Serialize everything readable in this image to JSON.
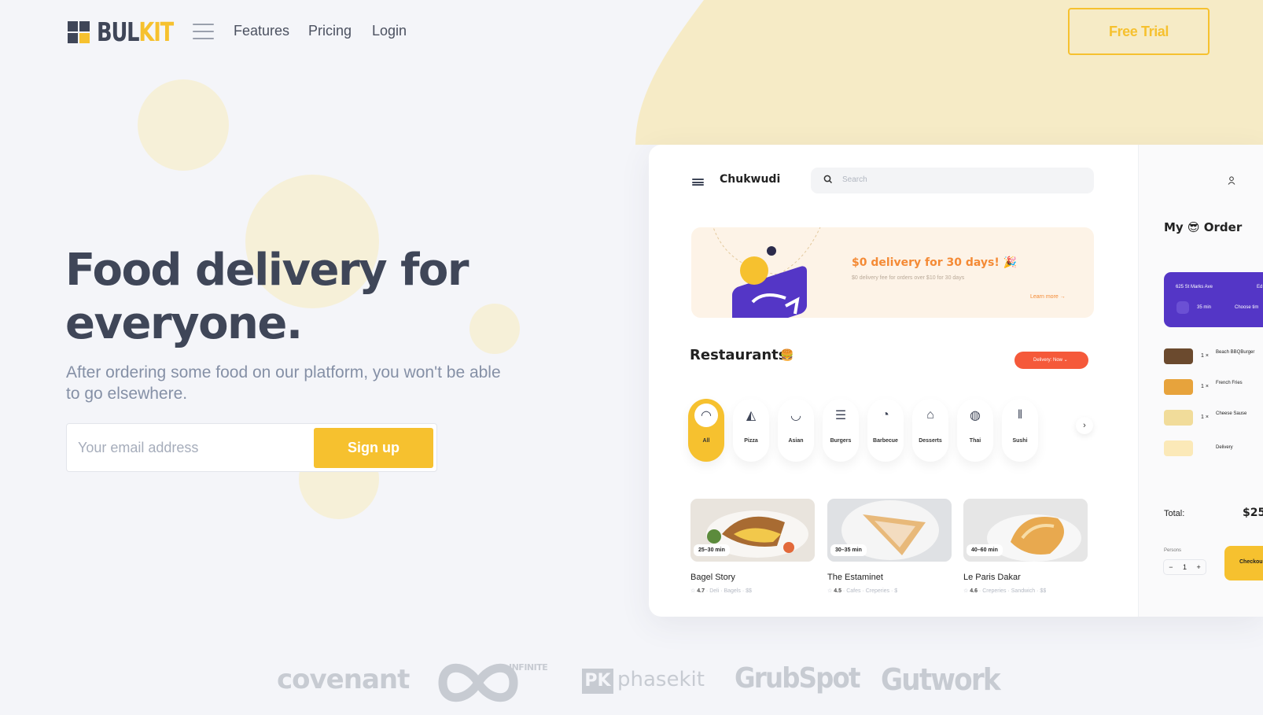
{
  "logo": {
    "text_a": "BUL",
    "text_b": "KIT"
  },
  "nav": {
    "links": [
      "Features",
      "Pricing",
      "Login"
    ],
    "cta": "Free Trial"
  },
  "hero": {
    "title": "Food delivery for everyone.",
    "subtitle": "After ordering some food on our platform, you won't be able to go elsewhere.",
    "email_placeholder": "Your email address",
    "signup_label": "Sign up"
  },
  "mockup": {
    "user": "Chukwudi",
    "search_placeholder": "Search",
    "banner": {
      "title": "$0 delivery for 30 days! 🎉",
      "subtitle": "$0 delivery fee for orders over $10 for 30 days",
      "link": "Learn more →"
    },
    "restaurants_title": "Restaurants",
    "restaurants_emoji": "🍔",
    "delivery_pill": "Delivery: Now ⌄",
    "categories": [
      "All",
      "Pizza",
      "Asian",
      "Burgers",
      "Barbecue",
      "Desserts",
      "Thai",
      "Sushi"
    ],
    "restaurants": [
      {
        "name": "Bagel Story",
        "time": "25–30 min",
        "rating": "4.7",
        "tags": "· Deli · Bagels · $$"
      },
      {
        "name": "The Estaminet",
        "time": "30–35 min",
        "rating": "4.5",
        "tags": "· Cafes · Creperies · $"
      },
      {
        "name": "Le Paris Dakar",
        "time": "40–60 min",
        "rating": "4.6",
        "tags": "· Creperies · Sandwich · $$"
      }
    ],
    "order": {
      "title": "My 😎 Order",
      "address": "625 St Marks Ave",
      "edit": "Ed",
      "time": "35 min",
      "choose_time": "Choose tim",
      "items": [
        {
          "qty": "1 ×",
          "name": "Beach BBQBurger"
        },
        {
          "qty": "1 ×",
          "name": "French Fries"
        },
        {
          "qty": "1 ×",
          "name": "Cheese Sause"
        },
        {
          "qty": "",
          "name": "Delivery"
        }
      ],
      "total_label": "Total:",
      "total_value": "$25",
      "persons_label": "Persons",
      "stepper_minus": "−",
      "persons_value": "1",
      "stepper_plus": "+",
      "checkout_label": "Checkou"
    }
  },
  "brands": [
    "covenant",
    "INFINITE",
    "phasekit",
    "GrubSpot",
    "Gutwork"
  ],
  "colors": {
    "accent": "#f6c12f",
    "text": "#3f4658",
    "muted": "#8590a6",
    "blob": "#f6f0d8",
    "orange": "#f48a35",
    "purple": "#5436c6"
  }
}
